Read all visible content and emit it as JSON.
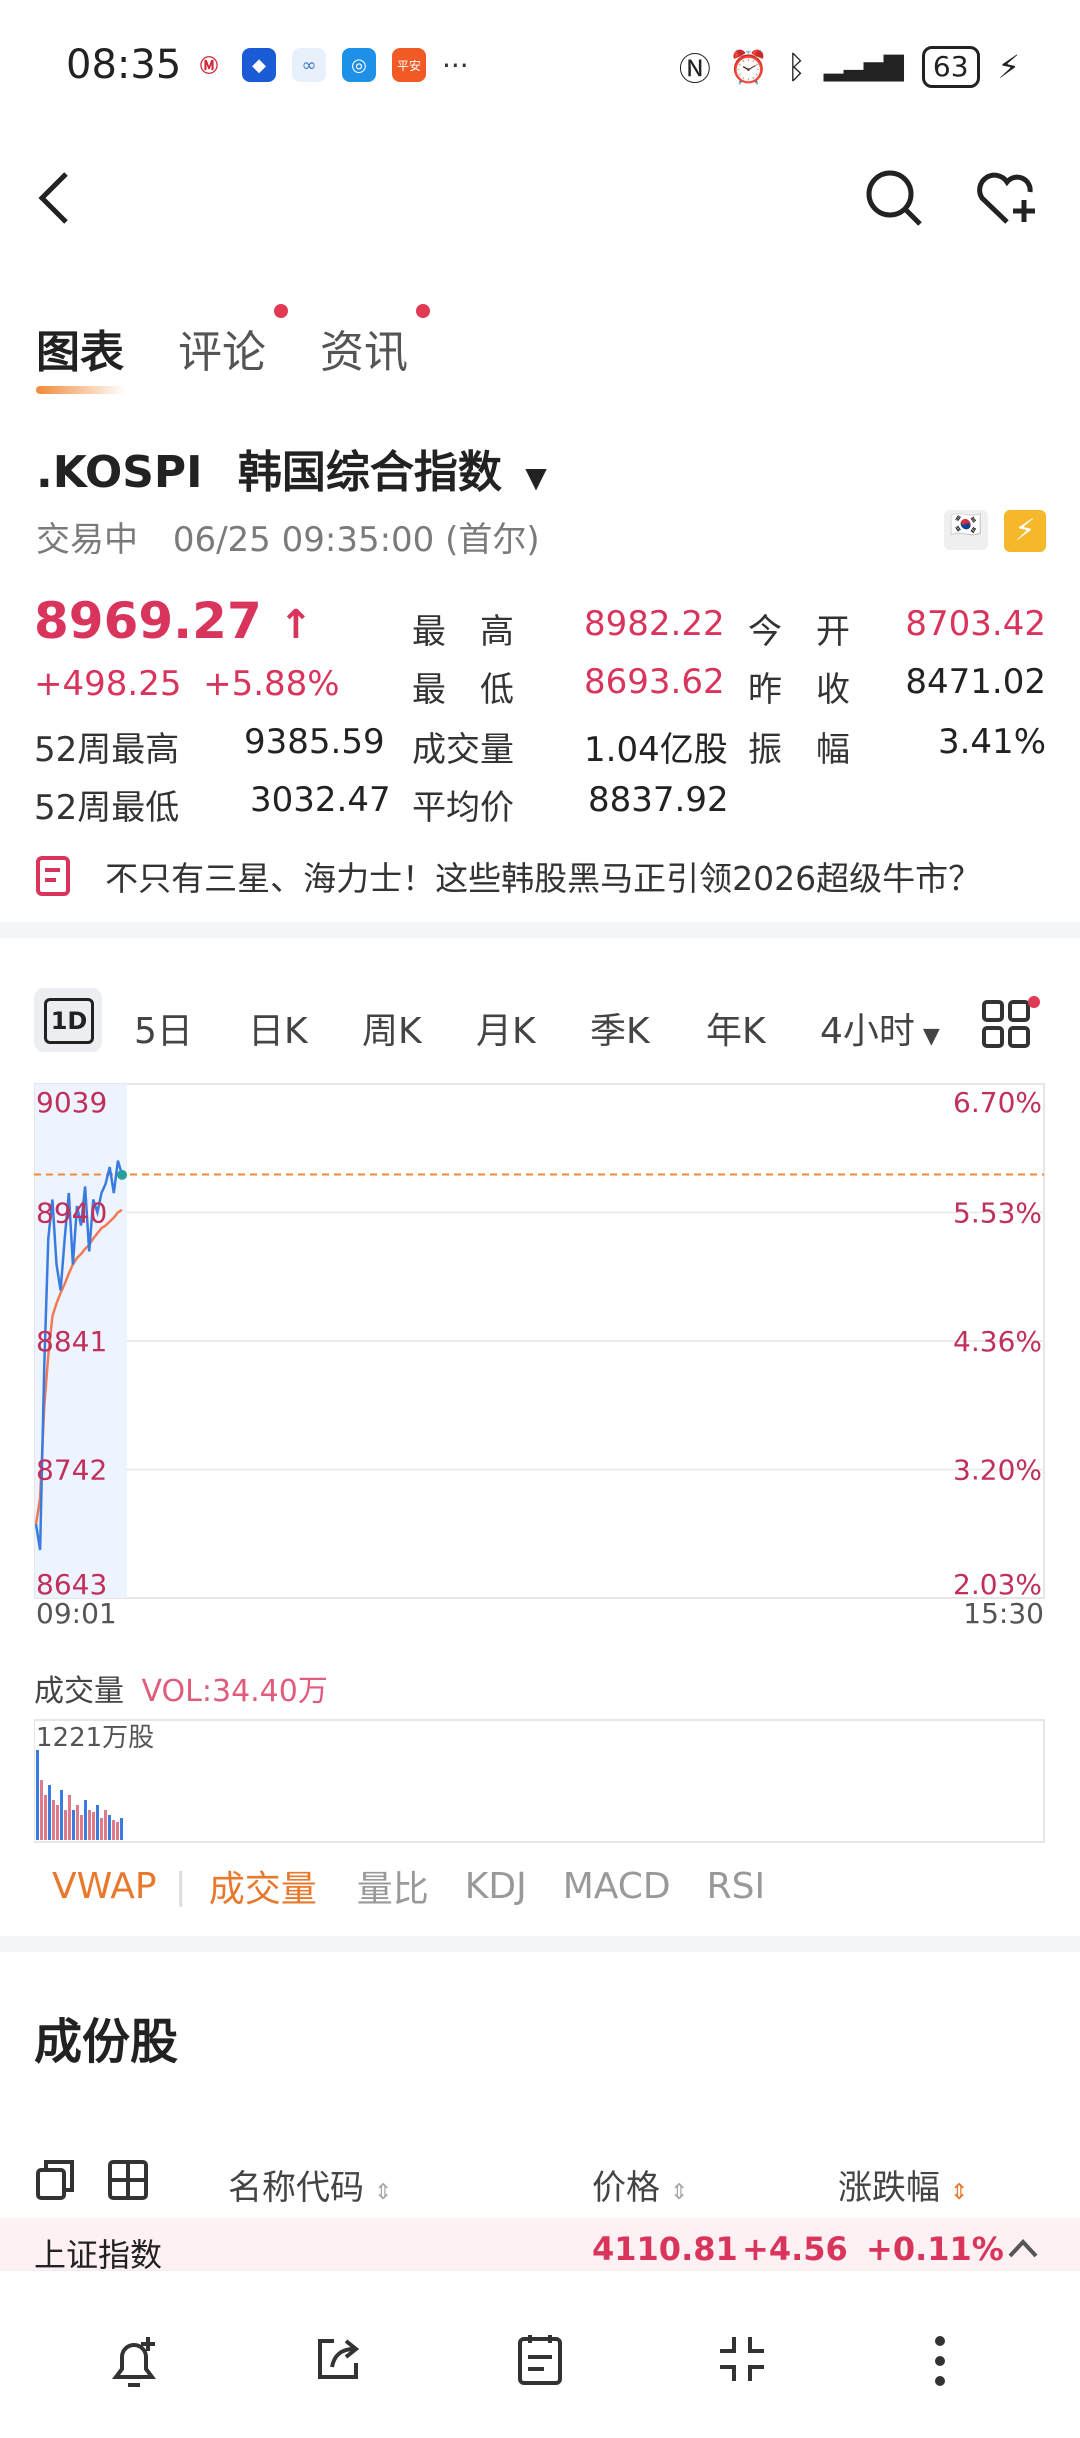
{
  "status": {
    "time": "08:35",
    "battery": "63",
    "dots": "···"
  },
  "tabs": [
    {
      "label": "图表",
      "active": true,
      "dot": false
    },
    {
      "label": "评论",
      "active": false,
      "dot": true
    },
    {
      "label": "资讯",
      "active": false,
      "dot": true
    }
  ],
  "quote": {
    "symbol": ".KOSPI",
    "name": "韩国综合指数",
    "status": "交易中",
    "datetime": "06/25 09:35:00 (首尔)",
    "price": "8969.27",
    "change": "+498.25",
    "change_pct": "+5.88%",
    "high_label": "最　高",
    "high": "8982.22",
    "open_label": "今　开",
    "open": "8703.42",
    "low_label": "最　低",
    "low": "8693.62",
    "prev_close_label": "昨　收",
    "prev_close": "8471.02",
    "w52_high_label": "52周最高",
    "w52_high": "9385.59",
    "volume_label": "成交量",
    "volume": "1.04亿股",
    "amplitude_label": "振　幅",
    "amplitude": "3.41%",
    "w52_low_label": "52周最低",
    "w52_low": "3032.47",
    "avg_label": "平均价",
    "avg": "8837.92"
  },
  "news": "不只有三星、海力士！这些韩股黑马正引领2026超级牛市？",
  "periods": [
    "1D",
    "5日",
    "日K",
    "周K",
    "月K",
    "季K",
    "年K",
    "4小时"
  ],
  "chart_data": {
    "type": "line",
    "y_ticks": [
      "9039",
      "8940",
      "8841",
      "8742",
      "8643"
    ],
    "pct_ticks": [
      "6.70%",
      "5.53%",
      "4.36%",
      "3.20%",
      "2.03%"
    ],
    "x_start": "09:01",
    "x_end": "15:30",
    "ylim": [
      8643,
      9039
    ],
    "prev_ref": 8969.27,
    "series": [
      {
        "values": [
          8700,
          8680,
          8820,
          8920,
          8950,
          8900,
          8880,
          8920,
          8955,
          8900,
          8945,
          8930,
          8960,
          8910,
          8950,
          8940,
          8955,
          8962,
          8975,
          8955,
          8980,
          8969
        ]
      },
      {
        "values": [
          8700,
          8720,
          8790,
          8830,
          8860,
          8870,
          8878,
          8885,
          8893,
          8900,
          8905,
          8908,
          8912,
          8915,
          8920,
          8924,
          8928,
          8930,
          8933,
          8936,
          8940,
          8942
        ]
      }
    ]
  },
  "volume": {
    "label": "成交量",
    "vol": "VOL:34.40万",
    "max": "1221万股",
    "bars": [
      0.9,
      0.6,
      0.45,
      0.55,
      0.4,
      0.35,
      0.5,
      0.3,
      0.45,
      0.3,
      0.35,
      0.25,
      0.4,
      0.3,
      0.28,
      0.35,
      0.22,
      0.3,
      0.25,
      0.2,
      0.18,
      0.22
    ]
  },
  "indicators": [
    "VWAP",
    "成交量",
    "量比",
    "KDJ",
    "MACD",
    "RSI"
  ],
  "components": {
    "title": "成份股",
    "cols": [
      "名称代码",
      "价格",
      "涨跌幅"
    ],
    "row": {
      "name": "上证指数",
      "price": "4110.81",
      "chg": "+4.56",
      "pct": "+0.11%"
    }
  },
  "colors": {
    "red": "#d9345c",
    "blue": "#3a7be0",
    "orange": "#f08a3a"
  }
}
